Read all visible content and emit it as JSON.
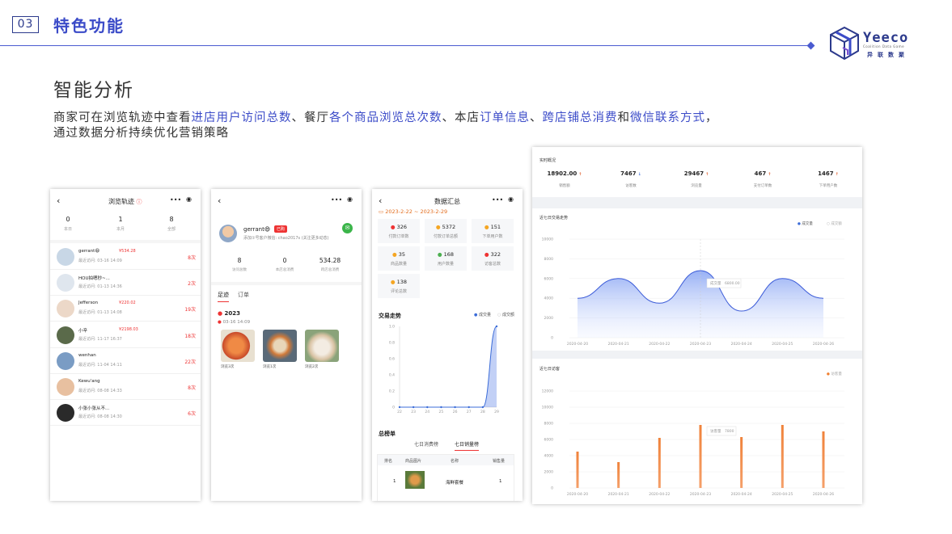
{
  "header": {
    "section_number": "03",
    "section_title": "特色功能",
    "brand": "Yeeco",
    "brand_sub": "Coalition Data Game",
    "brand_cn": "异联数聚"
  },
  "heading": "智能分析",
  "description": {
    "p1": "商家可在浏览轨迹中查看",
    "h1": "进店用户访问总数",
    "p2": "、餐厅",
    "h2": "各个商品浏览总次数",
    "p3": "、本店",
    "h3": "订单信息",
    "p4": "、",
    "h4": "跨店铺总消费",
    "p5": "和",
    "h5": "微信联系方式",
    "p6": "，",
    "line2": "通过数据分析持续优化营销策略"
  },
  "screen1": {
    "title": "浏览轨迹",
    "stats": [
      {
        "value": "0",
        "label": "本日"
      },
      {
        "value": "1",
        "label": "本月"
      },
      {
        "value": "8",
        "label": "全部"
      }
    ],
    "users": [
      {
        "name": "gerrant😄",
        "tag": "¥534.28",
        "visit": "最近访问: 03-16 14:09",
        "count": "8次"
      },
      {
        "name": "HOU拍嗯秒~...",
        "tag": "",
        "visit": "最近访问: 01-13 14:36",
        "count": "2次"
      },
      {
        "name": "Jefferson",
        "tag": "¥220.02",
        "visit": "最近访问: 01-13 14:08",
        "count": "19次"
      },
      {
        "name": "小辛",
        "tag": "¥2198.03",
        "visit": "最近访问: 11-17 16:37",
        "count": "18次"
      },
      {
        "name": "wenhan",
        "tag": "",
        "visit": "最近访问: 11-04 14:11",
        "count": "22次"
      },
      {
        "name": "Kewu'ang",
        "tag": "",
        "visit": "最近访问: 08-08 14:33",
        "count": "8次"
      },
      {
        "name": "小张小张从不...",
        "tag": "",
        "visit": "最近访问: 08-08 14:30",
        "count": "6次"
      }
    ]
  },
  "screen2": {
    "name": "gerrant😄",
    "badge": "已购",
    "wechat": "添加①号客户微信: chao2017s (关注更多动态)",
    "stats": [
      {
        "value": "8",
        "label": "访问总数"
      },
      {
        "value": "0",
        "label": "本店总消费"
      },
      {
        "value": "534.28",
        "label": "跨店总消费"
      }
    ],
    "tabs": [
      "足迹",
      "订单"
    ],
    "year": "2023",
    "date": "03-16 14:09",
    "foods": [
      {
        "label": "浏览3次"
      },
      {
        "label": "浏览1次"
      },
      {
        "label": "浏览2次"
      }
    ]
  },
  "screen3": {
    "title": "数据汇总",
    "date_range": "2023-2-22 ~ 2023-2-29",
    "cells": [
      {
        "value": "326",
        "label": "付款订单数",
        "color": "#e33"
      },
      {
        "value": "5372",
        "label": "付款订单总额",
        "color": "#f5a623"
      },
      {
        "value": "151",
        "label": "下单用户数",
        "color": "#f5a623"
      },
      {
        "value": "35",
        "label": "商品数量",
        "color": "#f5a623"
      },
      {
        "value": "168",
        "label": "用户数量",
        "color": "#4caf50"
      },
      {
        "value": "322",
        "label": "访客总数",
        "color": "#e33"
      },
      {
        "value": "138",
        "label": "评论总数",
        "color": "#f5a623"
      }
    ],
    "trend_title": "交易走势",
    "legend": [
      "成交量",
      "成交额"
    ],
    "rank_title": "总榜单",
    "rank_tabs": [
      "七日消费榜",
      "七日销量榜"
    ],
    "rank_headers": [
      "排名",
      "商品图片",
      "名称",
      "销售量"
    ],
    "rank_row": {
      "rank": "1",
      "name": "海鲜套餐",
      "sales": "1"
    }
  },
  "screen4": {
    "overview_title": "实时概况",
    "kpis": [
      {
        "value": "18902.00",
        "label": "销售额",
        "arrow": "↑",
        "color": "#e06030"
      },
      {
        "value": "7467",
        "label": "访客数",
        "arrow": "↓",
        "color": "#3b6cd8"
      },
      {
        "value": "29467",
        "label": "浏览量",
        "arrow": "↑",
        "color": "#e06030"
      },
      {
        "value": "467",
        "label": "支付订单数",
        "arrow": "↑",
        "color": "#e06030"
      },
      {
        "value": "1467",
        "label": "下单用户数",
        "arrow": "↑",
        "color": "#e06030"
      }
    ],
    "chart1_title": "近七日交易走势",
    "chart1_legend": [
      "成交量",
      "成交额"
    ],
    "tooltip1": {
      "label": "成交量",
      "value": "6800.00"
    },
    "chart2_title": "近七日访客",
    "chart2_legend": "访客量",
    "tooltip2": {
      "label": "访客量",
      "value": "7800"
    }
  },
  "chart_data": [
    {
      "type": "line",
      "title": "交易走势",
      "x": [
        "22",
        "23",
        "24",
        "25",
        "26",
        "27",
        "28",
        "29"
      ],
      "series": [
        {
          "name": "成交量",
          "values": [
            0,
            0,
            0,
            0,
            0,
            0,
            0,
            1.0
          ]
        }
      ],
      "ylim": [
        0,
        1.0
      ],
      "yticks": [
        "0",
        "0.2",
        "0.4",
        "0.6",
        "0.8",
        "1.0"
      ]
    },
    {
      "type": "area",
      "title": "近七日交易走势",
      "x": [
        "2020-04-20",
        "2020-04-21",
        "2020-04-22",
        "2020-04-23",
        "2020-04-24",
        "2020-04-25",
        "2020-04-26"
      ],
      "series": [
        {
          "name": "成交量",
          "values": [
            4000,
            6000,
            3500,
            6800,
            2700,
            6000,
            4000
          ]
        }
      ],
      "ylim": [
        0,
        10000
      ],
      "yticks": [
        "0",
        "2000",
        "4000",
        "6000",
        "8000",
        "10000"
      ]
    },
    {
      "type": "bar",
      "title": "近七日访客",
      "x": [
        "2020-04-20",
        "2020-04-21",
        "2020-04-22",
        "2020-04-23",
        "2020-04-24",
        "2020-04-25",
        "2020-04-26"
      ],
      "series": [
        {
          "name": "访客量",
          "values": [
            4500,
            3200,
            6200,
            7800,
            6300,
            7800,
            7000
          ]
        }
      ],
      "ylim": [
        0,
        12000
      ],
      "yticks": [
        "0",
        "2000",
        "4000",
        "6000",
        "8000",
        "10000",
        "12000"
      ]
    }
  ]
}
